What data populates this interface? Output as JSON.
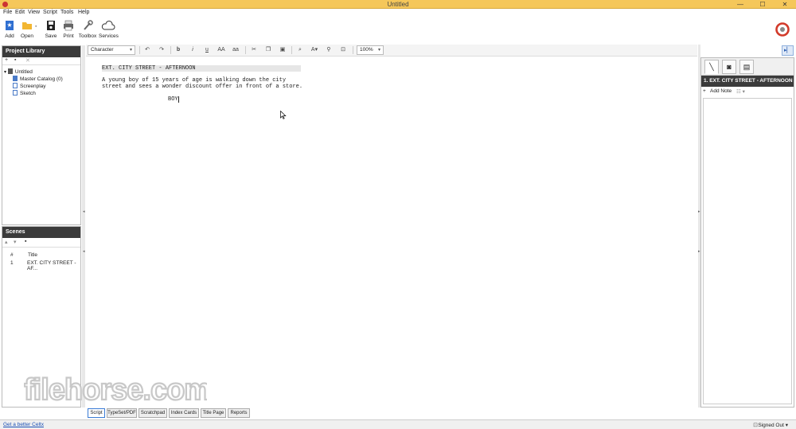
{
  "window": {
    "title": "Untitled",
    "controls": [
      "—",
      "☐",
      "✕"
    ]
  },
  "menu": [
    "File",
    "Edit",
    "View",
    "Script",
    "Tools",
    "Help"
  ],
  "toolbar": {
    "add": "Add",
    "open": "Open",
    "save": "Save",
    "print": "Print",
    "toolbox": "Toolbox",
    "services": "Services"
  },
  "project_library": {
    "title": "Project Library",
    "tools": [
      "+",
      "▪",
      "✕"
    ],
    "tree": [
      {
        "label": "Untitled"
      },
      {
        "label": "Master Catalog (0)"
      },
      {
        "label": "Screenplay"
      },
      {
        "label": "Sketch"
      }
    ]
  },
  "scenes": {
    "title": "Scenes",
    "columns": [
      "#",
      "Title"
    ],
    "rows": [
      {
        "num": "1",
        "title": "EXT. CITY STREET - AF..."
      }
    ]
  },
  "format_toolbar": {
    "element": "Character",
    "zoom": "100%",
    "buttons": [
      "↶",
      "↷",
      "b",
      "i",
      "u",
      "AA",
      "aa"
    ]
  },
  "script": {
    "scene_heading": "EXT. CITY STREET - AFTERNOON",
    "action_line1": "A young boy of 15 years of age is walking down the city",
    "action_line2": "street and sees a wonder discount offer in front of a store.",
    "character": "BOY"
  },
  "right_panel": {
    "scene_title": "1. EXT. CITY STREET - AFTERNOON",
    "add_note": "Add Note"
  },
  "bottom_tabs": [
    "Script",
    "TypeSet/PDF",
    "Scratchpad",
    "Index Cards",
    "Title Page",
    "Reports"
  ],
  "status": {
    "link": "Get a better Celtx",
    "signed": "Signed Out"
  },
  "watermark": "filehorse.com",
  "colors": {
    "titlebar": "#f5c75a",
    "panel_header": "#3b3b3b",
    "accent": "#3a7bd5"
  }
}
